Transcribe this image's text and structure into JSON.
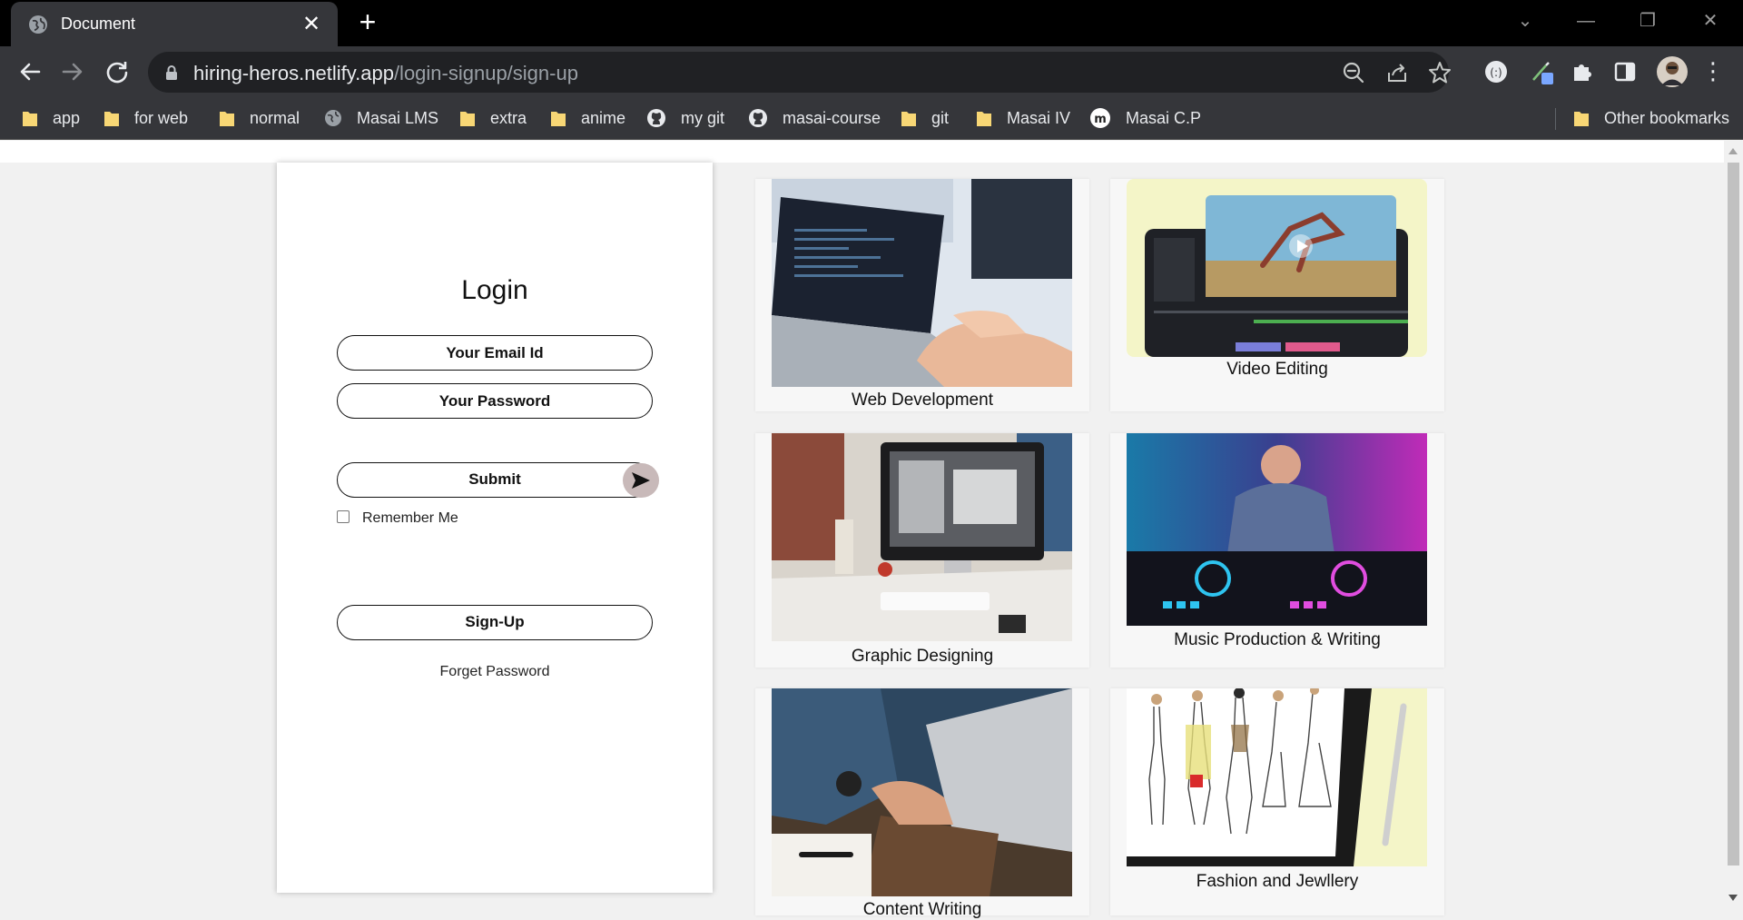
{
  "browser": {
    "tab_title": "Document",
    "url_host": "hiring-heros.netlify.app",
    "url_path": "/login-signup/sign-up",
    "bookmarks": [
      "app",
      "for web",
      "normal",
      "Masai LMS",
      "extra",
      "anime",
      "my git",
      "masai-course",
      "git",
      "Masai IV",
      "Masai C.P"
    ],
    "other_bookmarks": "Other bookmarks"
  },
  "login": {
    "title": "Login",
    "email_placeholder": "Your Email Id",
    "password_placeholder": "Your Password",
    "submit_label": "Submit",
    "remember_label": "Remember Me",
    "signup_label": "Sign-Up",
    "forget_label": "Forget Password"
  },
  "courses": [
    {
      "title": "Web Development"
    },
    {
      "title": "Video Editing"
    },
    {
      "title": "Graphic Designing"
    },
    {
      "title": "Music Production & Writing"
    },
    {
      "title": "Content Writing"
    },
    {
      "title": "Fashion and Jewllery"
    }
  ],
  "colors": {
    "chrome_dark": "#35363a",
    "omnibox": "#202124",
    "page_bg": "#f1f1f1",
    "submit_arrow_bg": "#c8b9b9"
  }
}
